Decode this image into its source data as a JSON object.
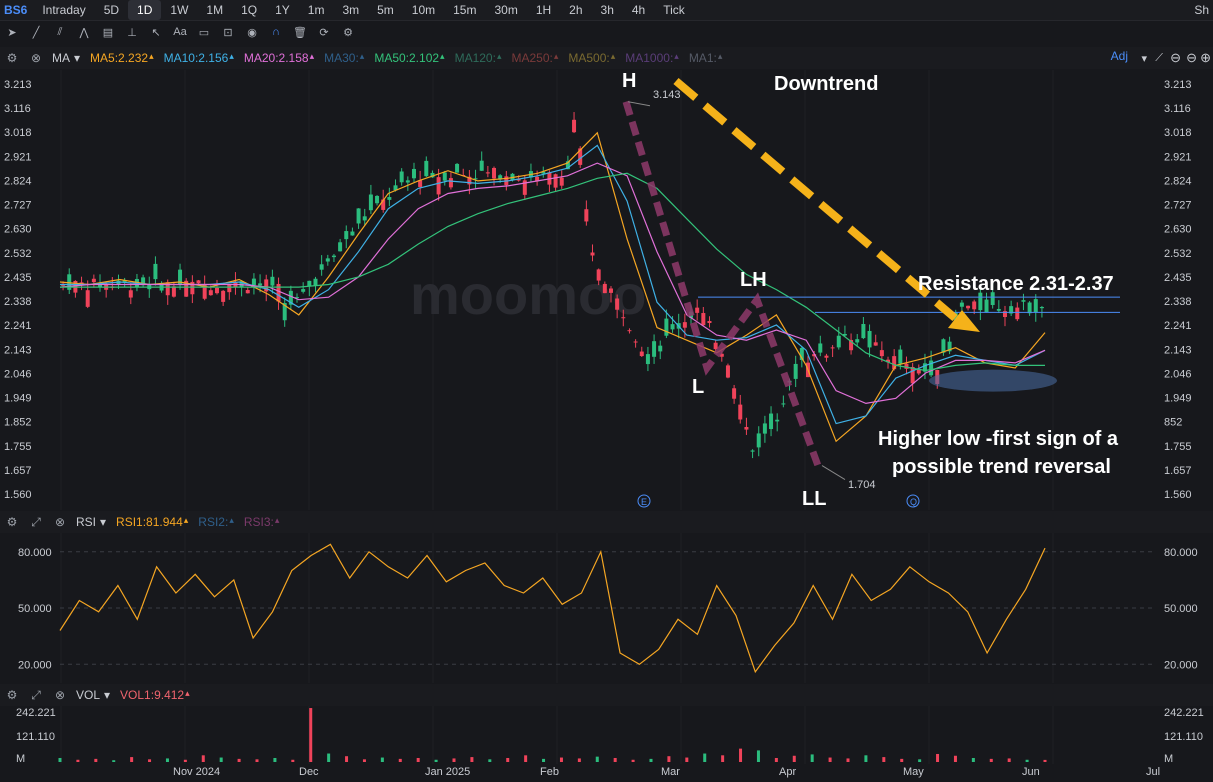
{
  "topbar": {
    "ticker": "BS6",
    "timeframes": [
      "Intraday",
      "5D",
      "1D",
      "1W",
      "1M",
      "1Q",
      "1Y",
      "1m",
      "3m",
      "5m",
      "10m",
      "15m",
      "30m",
      "1H",
      "2h",
      "3h",
      "4h",
      "Tick"
    ],
    "active": "1D",
    "right_text": "Sh"
  },
  "ma_legend": {
    "label": "MA",
    "items": [
      {
        "text": "MA5:2.232",
        "color": "#f5a623"
      },
      {
        "text": "MA10:2.156",
        "color": "#3fb1e6"
      },
      {
        "text": "MA20:2.158",
        "color": "#e070d8"
      },
      {
        "text": "MA30:",
        "color": "#2f5f8a"
      },
      {
        "text": "MA50:2.102",
        "color": "#33c27a"
      },
      {
        "text": "MA120:",
        "color": "#2e6b5a"
      },
      {
        "text": "MA250:",
        "color": "#7a3a3a"
      },
      {
        "text": "MA500:",
        "color": "#7a6a30"
      },
      {
        "text": "MA1000:",
        "color": "#5a3d78"
      },
      {
        "text": "MA1:",
        "color": "#555a66"
      }
    ],
    "adj": "Adj"
  },
  "price_axis": [
    "3.213",
    "3.116",
    "3.018",
    "2.921",
    "2.824",
    "2.727",
    "2.630",
    "2.532",
    "2.435",
    "2.338",
    "2.241",
    "2.143",
    "2.046",
    "1.949",
    "1.852",
    "1.755",
    "1.657",
    "1.560"
  ],
  "price_axis_right": [
    "3.213",
    "3.116",
    "3.018",
    "2.921",
    "2.824",
    "2.727",
    "2.630",
    "2.532",
    "2.435",
    "2.338",
    "2.241",
    "2.143",
    "2.046",
    "1.949",
    "852",
    "1.755",
    "1.657",
    "1.560"
  ],
  "annotations": {
    "h": "H",
    "h_price": "3.143",
    "downtrend": "Downtrend",
    "l": "L",
    "lh": "LH",
    "ll": "LL",
    "ll_price": "1.704",
    "resistance": "Resistance 2.31-2.37",
    "higher_low_1": "Higher low -first sign of a",
    "higher_low_2": "possible trend reversal",
    "e_marker": "E",
    "q_marker": "Q"
  },
  "rsi_legend": {
    "label": "RSI",
    "items": [
      {
        "text": "RSI1:81.944",
        "color": "#f5a623"
      },
      {
        "text": "RSI2:",
        "color": "#2f5f8a"
      },
      {
        "text": "RSI3:",
        "color": "#7a3a6a"
      }
    ]
  },
  "rsi_axis": [
    "80.000",
    "50.000",
    "20.000"
  ],
  "vol_legend": {
    "label": "VOL",
    "items": [
      {
        "text": "VOL1:9.412",
        "color": "#f0646e"
      }
    ]
  },
  "vol_axis": [
    "242.221",
    "121.110",
    "M"
  ],
  "x_axis": [
    "Nov 2024",
    "Dec",
    "Jan 2025",
    "Feb",
    "Mar",
    "Apr",
    "May",
    "Jun",
    "Jul"
  ],
  "watermark": "moomoo",
  "colors": {
    "up": "#2bbd7e",
    "down": "#f0435a",
    "annotation_arrow": "#f5b21a",
    "pattern": "#8e3a6a"
  },
  "chart_data": [
    {
      "type": "candlestick",
      "title": "",
      "ylim": [
        1.56,
        3.213
      ],
      "x": [
        "Nov 2024",
        "Dec",
        "Jan 2025",
        "Feb",
        "Mar",
        "Apr",
        "May",
        "Jun",
        "Jul"
      ],
      "series": [
        {
          "name": "MA5",
          "values": [
            2.43,
            2.42,
            2.44,
            2.42,
            2.43,
            2.41,
            2.44,
            2.38,
            2.3,
            2.45,
            2.62,
            2.78,
            2.83,
            2.87,
            2.83,
            2.84,
            2.86,
            2.9,
            3.02,
            2.6,
            2.25,
            2.2,
            2.15,
            2.22,
            2.3,
            2.1,
            1.8,
            1.9,
            2.1,
            2.13,
            2.17,
            2.11,
            2.09,
            2.23
          ]
        },
        {
          "name": "MA10",
          "values": [
            2.42,
            2.42,
            2.43,
            2.42,
            2.42,
            2.42,
            2.43,
            2.4,
            2.33,
            2.4,
            2.55,
            2.72,
            2.8,
            2.83,
            2.82,
            2.83,
            2.85,
            2.88,
            2.97,
            2.75,
            2.35,
            2.22,
            2.2,
            2.21,
            2.26,
            2.16,
            1.87,
            1.9,
            2.05,
            2.1,
            2.14,
            2.12,
            2.1,
            2.16
          ]
        },
        {
          "name": "MA20",
          "values": [
            2.41,
            2.42,
            2.42,
            2.42,
            2.42,
            2.42,
            2.42,
            2.41,
            2.36,
            2.37,
            2.45,
            2.6,
            2.72,
            2.78,
            2.8,
            2.81,
            2.83,
            2.85,
            2.9,
            2.85,
            2.55,
            2.3,
            2.22,
            2.2,
            2.24,
            2.2,
            2.0,
            1.95,
            1.97,
            2.07,
            2.12,
            2.12,
            2.11,
            2.16
          ]
        },
        {
          "name": "MA50",
          "values": [
            2.41,
            2.41,
            2.41,
            2.41,
            2.41,
            2.41,
            2.41,
            2.41,
            2.41,
            2.42,
            2.45,
            2.5,
            2.58,
            2.65,
            2.7,
            2.74,
            2.77,
            2.8,
            2.84,
            2.86,
            2.8,
            2.68,
            2.56,
            2.46,
            2.4,
            2.33,
            2.24,
            2.15,
            2.1,
            2.08,
            2.1,
            2.11,
            2.1,
            2.1
          ]
        }
      ],
      "annotations": {
        "high": 3.143,
        "low": 1.704,
        "resistance": [
          2.31,
          2.37
        ]
      }
    },
    {
      "type": "line",
      "title": "",
      "ylim": [
        10,
        90
      ],
      "series": [
        {
          "name": "RSI1",
          "values": [
            38,
            54,
            48,
            62,
            44,
            72,
            58,
            68,
            56,
            65,
            34,
            48,
            70,
            78,
            84,
            66,
            80,
            72,
            66,
            78,
            64,
            70,
            74,
            62,
            58,
            66,
            52,
            58,
            80,
            26,
            20,
            28,
            44,
            36,
            62,
            46,
            16,
            30,
            42,
            62,
            44,
            68,
            54,
            60,
            72,
            64,
            58,
            48,
            26,
            44,
            60,
            81.944
          ]
        }
      ]
    },
    {
      "type": "bar",
      "title": "",
      "ylim": [
        0,
        242.221
      ],
      "values": [
        18,
        10,
        14,
        8,
        22,
        12,
        16,
        10,
        30,
        20,
        14,
        12,
        18,
        10,
        242,
        38,
        26,
        12,
        20,
        14,
        18,
        10,
        16,
        22,
        12,
        18,
        30,
        14,
        20,
        16,
        24,
        18,
        10,
        14,
        26,
        20,
        38,
        30,
        60,
        52,
        18,
        28,
        34,
        20,
        16,
        30,
        22,
        14,
        12,
        36,
        28,
        18,
        14,
        16,
        10,
        9.412
      ]
    }
  ]
}
